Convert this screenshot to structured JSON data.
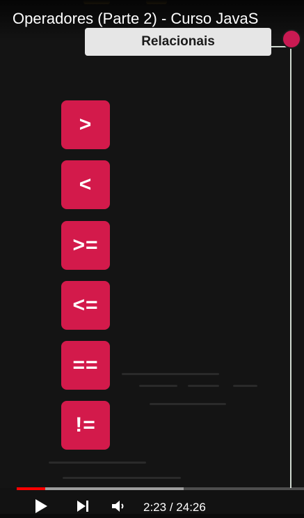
{
  "video": {
    "title": "Operadores (Parte 2) - Curso JavaS",
    "heading": "Relacionais",
    "operators": [
      ">",
      "<",
      ">=",
      "<=",
      "==",
      "!="
    ]
  },
  "player": {
    "progress_played": 0.0981,
    "progress_buffered": 0.58,
    "current_time": "2:23",
    "separator": "/",
    "duration": "24:26"
  },
  "icons": [
    "play-icon",
    "next-icon",
    "volume-icon"
  ],
  "colors": {
    "operator_bg": "#d31a4b",
    "heading_bg": "#e6e6e6",
    "progress_red": "#ff0000",
    "record_dot": "#c91a52"
  }
}
